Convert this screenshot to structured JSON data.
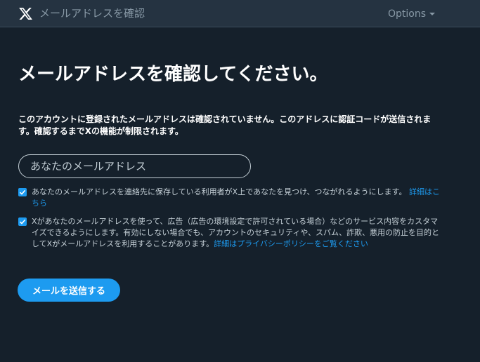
{
  "header": {
    "title": "メールアドレスを確認",
    "options_label": "Options"
  },
  "main": {
    "title": "メールアドレスを確認してください。",
    "description": "このアカウントに登録されたメールアドレスは確認されていません。このアドレスに認証コードが送信されます。確認するまでXの機能が制限されます。",
    "email_placeholder": "あなたのメールアドレス",
    "email_value": ""
  },
  "consents": [
    {
      "checked": true,
      "text": "あなたのメールアドレスを連絡先に保存している利用者がX上であなたを見つけ、つながれるようにします。",
      "link_label": "詳細はこちら"
    },
    {
      "checked": true,
      "text": "Xがあなたのメールアドレスを使って、広告（広告の環境設定で許可されている場合）などのサービス内容をカスタマイズできるようにします。有効にしない場合でも、アカウントのセキュリティや、スパム、詐欺、悪用の防止を目的としてXがメールアドレスを利用することがあります。",
      "link_label": "詳細はプライバシーポリシーをご覧ください"
    }
  ],
  "actions": {
    "send_label": "メールを送信する"
  },
  "colors": {
    "background": "#15202b",
    "topbar": "#253341",
    "accent": "#1d9bf0",
    "muted_text": "#8899a6"
  },
  "icons": {
    "logo": "x-logo-icon",
    "dropdown": "caret-down-icon",
    "check": "checkmark-icon"
  }
}
